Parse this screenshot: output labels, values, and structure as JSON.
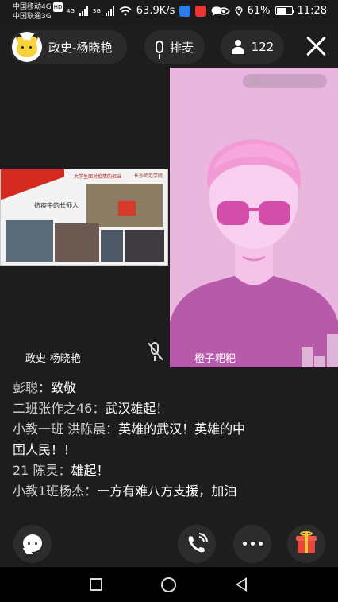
{
  "status_bar": {
    "carrier1": "中国移动4G",
    "carrier1_badge": "HD",
    "carrier2": "中国联通3G",
    "net1": "4G",
    "net2": "3G",
    "speed": "63.9K/s",
    "battery": "61%",
    "battery_level": 0.61,
    "time": "11:28"
  },
  "header": {
    "host_name": "政史-杨晓艳",
    "queue_label": "排麦",
    "viewer_count": "122"
  },
  "video": {
    "slide_title": "大学生面对疫情的担当",
    "slide_caption": "抗疫中的长师人",
    "slide_logo": "长沙师范学院",
    "left_label": "政史-杨晓艳",
    "room_id": "ID:11706381",
    "right_label": "橙子粑粑"
  },
  "chat": [
    {
      "who": "彭聪：",
      "text": "致敬"
    },
    {
      "who": "二班张作之46：",
      "text": "武汉雄起！"
    },
    {
      "who": "小教一班 洪陈晨：",
      "text": "英雄的武汉！英雄的中国人民！！"
    },
    {
      "who": "21 陈灵：",
      "text": "雄起！"
    },
    {
      "who": "小教1班杨杰：",
      "text": "一方有难八方支援，加油"
    }
  ],
  "colors": {
    "background": "#1d1d1d",
    "cam_background": "#e9b6de",
    "avatar_pink": "#f19ad6",
    "gift_red": "#e8453c"
  },
  "icons": [
    "pikachu-avatar-icon",
    "mic-icon",
    "person-icon",
    "close-icon",
    "mic-muted-icon",
    "camera-icon",
    "chat-bubble-icon",
    "phone-icon",
    "more-icon",
    "gift-icon",
    "nav-back-icon",
    "nav-home-icon",
    "nav-recents-icon"
  ]
}
